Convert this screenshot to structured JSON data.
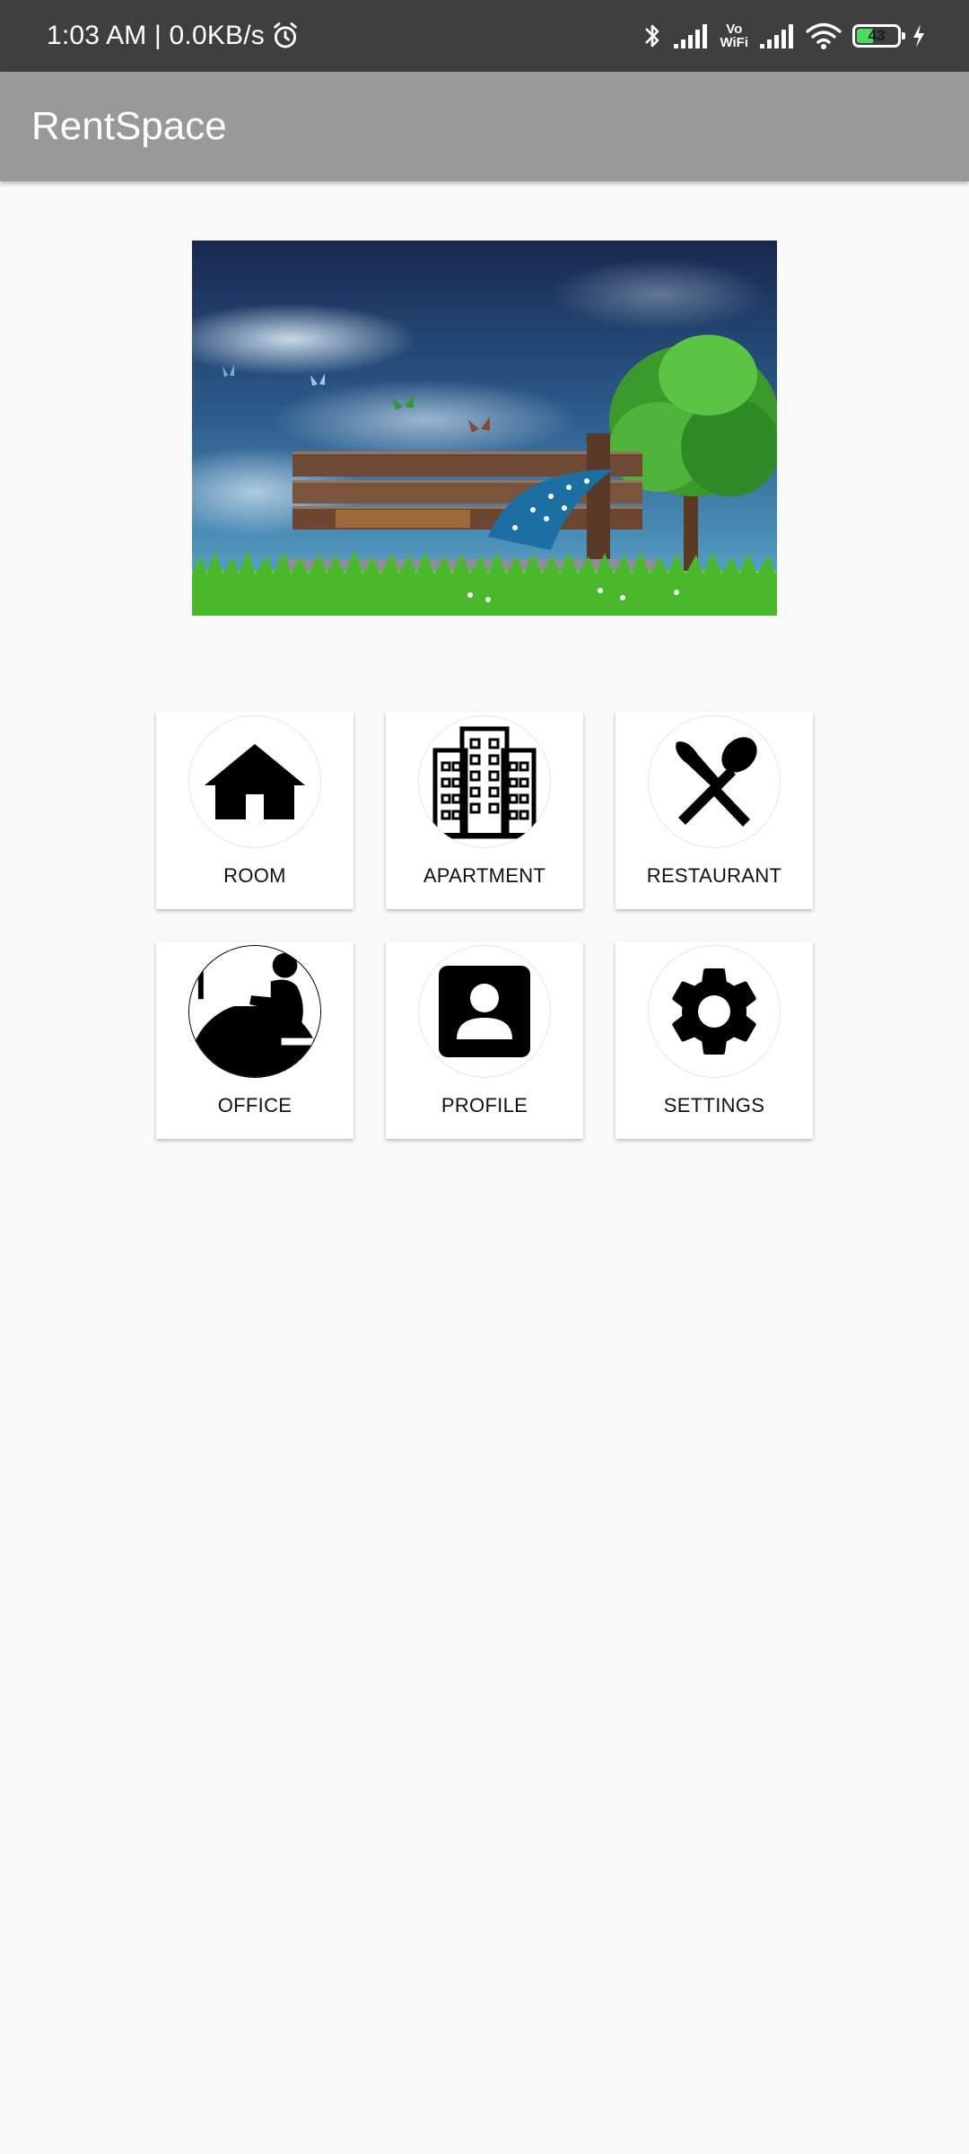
{
  "status_bar": {
    "time_speed": "1:03 AM | 0.0KB/s",
    "vo_top": "Vo",
    "vo_bottom": "WiFi",
    "battery_level": "43",
    "battery_fraction": 0.43
  },
  "app_bar": {
    "title": "RentSpace"
  },
  "tiles": [
    {
      "label": "ROOM",
      "icon": "house-icon"
    },
    {
      "label": "APARTMENT",
      "icon": "apartment-building-icon"
    },
    {
      "label": "RESTAURANT",
      "icon": "fork-spoon-icon"
    },
    {
      "label": "OFFICE",
      "icon": "person-at-desk-icon"
    },
    {
      "label": "PROFILE",
      "icon": "profile-icon"
    },
    {
      "label": "SETTINGS",
      "icon": "gear-icon"
    }
  ],
  "colors": {
    "status_bar": "#3f3f3f",
    "app_bar": "#999999",
    "background": "#fafafa",
    "battery": "#4cd964"
  }
}
